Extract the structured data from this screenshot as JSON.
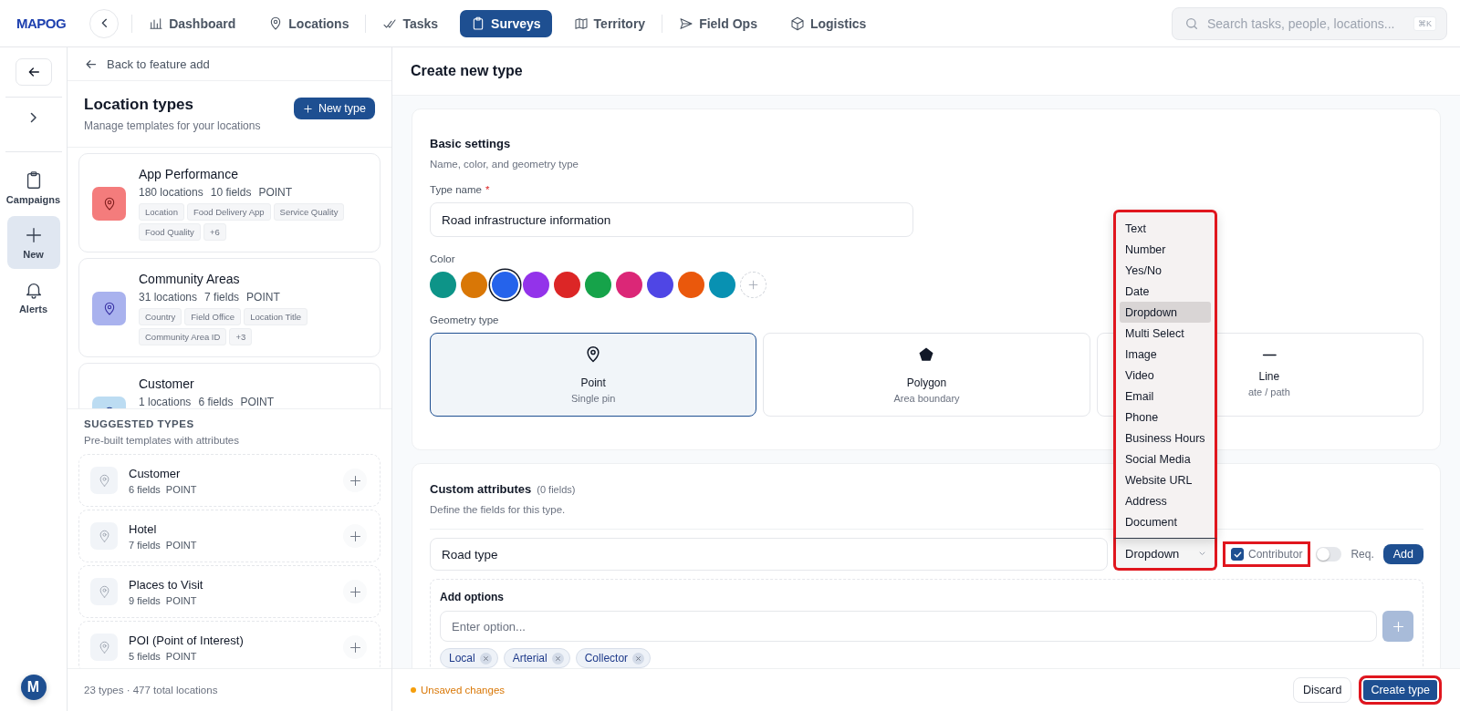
{
  "topbar": {
    "logo": "MAPOG",
    "nav": [
      {
        "label": "Dashboard",
        "selected": false
      },
      {
        "label": "Locations",
        "selected": false
      },
      {
        "label": "Tasks",
        "selected": false
      },
      {
        "label": "Surveys",
        "selected": true
      },
      {
        "label": "Territory",
        "selected": false
      },
      {
        "label": "Field Ops",
        "selected": false
      },
      {
        "label": "Logistics",
        "selected": false
      }
    ],
    "search": {
      "placeholder": "Search tasks, people, locations...",
      "shortcut": "⌘K"
    }
  },
  "rail": {
    "items": [
      {
        "label": "Campaigns",
        "selected": false
      },
      {
        "label": "New",
        "selected": true
      },
      {
        "label": "Alerts",
        "selected": false
      }
    ],
    "avatar": "M"
  },
  "panel": {
    "back": "Back to feature add",
    "title": "Location types",
    "subtitle": "Manage templates for your locations",
    "new_button": "New type",
    "types": [
      {
        "name": "App Performance",
        "locations": "180 locations",
        "fields": "10 fields",
        "geometry": "POINT",
        "color": "#f47c7c",
        "tags": [
          "Location",
          "Food Delivery App",
          "Service Quality",
          "Food Quality",
          "+6"
        ]
      },
      {
        "name": "Community Areas",
        "locations": "31 locations",
        "fields": "7 fields",
        "geometry": "POINT",
        "color": "#a9b2ee",
        "tags": [
          "Country",
          "Field Office",
          "Location Title",
          "Community Area ID",
          "+3"
        ]
      },
      {
        "name": "Customer",
        "locations": "1 locations",
        "fields": "6 fields",
        "geometry": "POINT",
        "color": "#bcdcf2"
      }
    ],
    "suggested_title": "SUGGESTED TYPES",
    "suggested_subtitle": "Pre-built templates with attributes",
    "suggested": [
      {
        "name": "Customer",
        "fields": "6 fields",
        "geometry": "POINT"
      },
      {
        "name": "Hotel",
        "fields": "7 fields",
        "geometry": "POINT"
      },
      {
        "name": "Places to Visit",
        "fields": "9 fields",
        "geometry": "POINT"
      },
      {
        "name": "POI (Point of Interest)",
        "fields": "5 fields",
        "geometry": "POINT"
      }
    ],
    "footer": "23 types · 477 total locations"
  },
  "main": {
    "title": "Create new type",
    "basic": {
      "title": "Basic settings",
      "subtitle": "Name, color, and geometry type",
      "name_label": "Type name",
      "required_mark": "*",
      "name_value": "Road infrastructure information",
      "color_label": "Color",
      "colors": [
        {
          "color": "#0d9488",
          "selected": false
        },
        {
          "color": "#d97706",
          "selected": false
        },
        {
          "color": "#2563eb",
          "selected": true
        },
        {
          "color": "#9333ea",
          "selected": false
        },
        {
          "color": "#dc2626",
          "selected": false
        },
        {
          "color": "#16a34a",
          "selected": false
        },
        {
          "color": "#db2777",
          "selected": false
        },
        {
          "color": "#4f46e5",
          "selected": false
        },
        {
          "color": "#ea580c",
          "selected": false
        },
        {
          "color": "#0891b2",
          "selected": false
        }
      ],
      "geometry_label": "Geometry type",
      "geometries": [
        {
          "kind": "point",
          "label": "Point",
          "sub": "Single pin",
          "selected": true
        },
        {
          "kind": "polygon",
          "label": "Polygon",
          "sub": "Area boundary",
          "selected": false
        },
        {
          "kind": "line",
          "label": "Line",
          "sub": "ate / path",
          "selected": false
        }
      ]
    },
    "attributes": {
      "title": "Custom attributes",
      "count": "(0 fields)",
      "subtitle": "Define the fields for this type.",
      "row": {
        "name_value": "Road type",
        "type_value": "Dropdown",
        "highlighted": true,
        "contributor": {
          "label": "Contributor",
          "checked": true,
          "highlighted": true
        },
        "required": {
          "label": "Req.",
          "on": false
        },
        "add": "Add"
      },
      "menu": [
        {
          "label": "Text",
          "selected": false
        },
        {
          "label": "Number",
          "selected": false
        },
        {
          "label": "Yes/No",
          "selected": false
        },
        {
          "label": "Date",
          "selected": false
        },
        {
          "label": "Dropdown",
          "selected": true
        },
        {
          "label": "Multi Select",
          "selected": false
        },
        {
          "label": "Image",
          "selected": false
        },
        {
          "label": "Video",
          "selected": false
        },
        {
          "label": "Email",
          "selected": false
        },
        {
          "label": "Phone",
          "selected": false
        },
        {
          "label": "Business Hours",
          "selected": false
        },
        {
          "label": "Social Media",
          "selected": false
        },
        {
          "label": "Website URL",
          "selected": false
        },
        {
          "label": "Address",
          "selected": false
        },
        {
          "label": "Document",
          "selected": false
        }
      ],
      "options": {
        "title": "Add options",
        "placeholder": "Enter option...",
        "add_disabled": true,
        "chips": [
          "Local",
          "Arterial",
          "Collector"
        ]
      }
    }
  },
  "footer": {
    "status": "Unsaved changes",
    "discard": "Discard",
    "create": {
      "label": "Create type",
      "highlighted": true
    }
  }
}
